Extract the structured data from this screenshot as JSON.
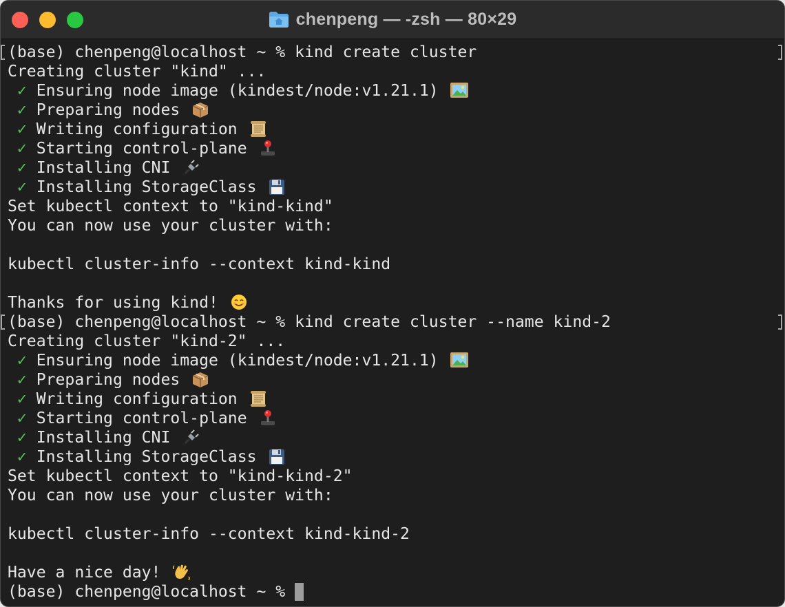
{
  "window": {
    "title": "chenpeng — -zsh — 80×29",
    "folder_icon": "home-folder-icon",
    "colors": {
      "close": "#fe5f57",
      "minimize": "#febc2e",
      "maximize": "#28c840",
      "background": "#1e1e1e",
      "check": "#58c45c"
    }
  },
  "terminal": {
    "lines": [
      {
        "prompt": "(base) chenpeng@localhost ~ % ",
        "command": "kind create cluster"
      },
      {
        "text": "Creating cluster \"kind\" ..."
      },
      {
        "check": "✓",
        "text": " Ensuring node image (kindest/node:v1.21.1) ",
        "emoji": "framed-picture-icon"
      },
      {
        "check": "✓",
        "text": " Preparing nodes ",
        "emoji": "package-box-icon"
      },
      {
        "check": "✓",
        "text": " Writing configuration ",
        "emoji": "scroll-icon"
      },
      {
        "check": "✓",
        "text": " Starting control-plane ",
        "emoji": "joystick-icon"
      },
      {
        "check": "✓",
        "text": " Installing CNI ",
        "emoji": "plug-icon"
      },
      {
        "check": "✓",
        "text": " Installing StorageClass ",
        "emoji": "floppy-disk-icon"
      },
      {
        "text": "Set kubectl context to \"kind-kind\""
      },
      {
        "text": "You can now use your cluster with:"
      },
      {
        "text": ""
      },
      {
        "text": "kubectl cluster-info --context kind-kind"
      },
      {
        "text": ""
      },
      {
        "text": "Thanks for using kind! ",
        "emoji": "smiling-face-icon"
      },
      {
        "prompt": "(base) chenpeng@localhost ~ % ",
        "command": "kind create cluster --name kind-2"
      },
      {
        "text": "Creating cluster \"kind-2\" ..."
      },
      {
        "check": "✓",
        "text": " Ensuring node image (kindest/node:v1.21.1) ",
        "emoji": "framed-picture-icon"
      },
      {
        "check": "✓",
        "text": " Preparing nodes ",
        "emoji": "package-box-icon"
      },
      {
        "check": "✓",
        "text": " Writing configuration ",
        "emoji": "scroll-icon"
      },
      {
        "check": "✓",
        "text": " Starting control-plane ",
        "emoji": "joystick-icon"
      },
      {
        "check": "✓",
        "text": " Installing CNI ",
        "emoji": "plug-icon"
      },
      {
        "check": "✓",
        "text": " Installing StorageClass ",
        "emoji": "floppy-disk-icon"
      },
      {
        "text": "Set kubectl context to \"kind-kind-2\""
      },
      {
        "text": "You can now use your cluster with:"
      },
      {
        "text": ""
      },
      {
        "text": "kubectl cluster-info --context kind-kind-2"
      },
      {
        "text": ""
      },
      {
        "text": "Have a nice day! ",
        "emoji": "waving-hand-icon"
      },
      {
        "prompt": "(base) chenpeng@localhost ~ % ",
        "command": "",
        "cursor": true
      }
    ]
  }
}
